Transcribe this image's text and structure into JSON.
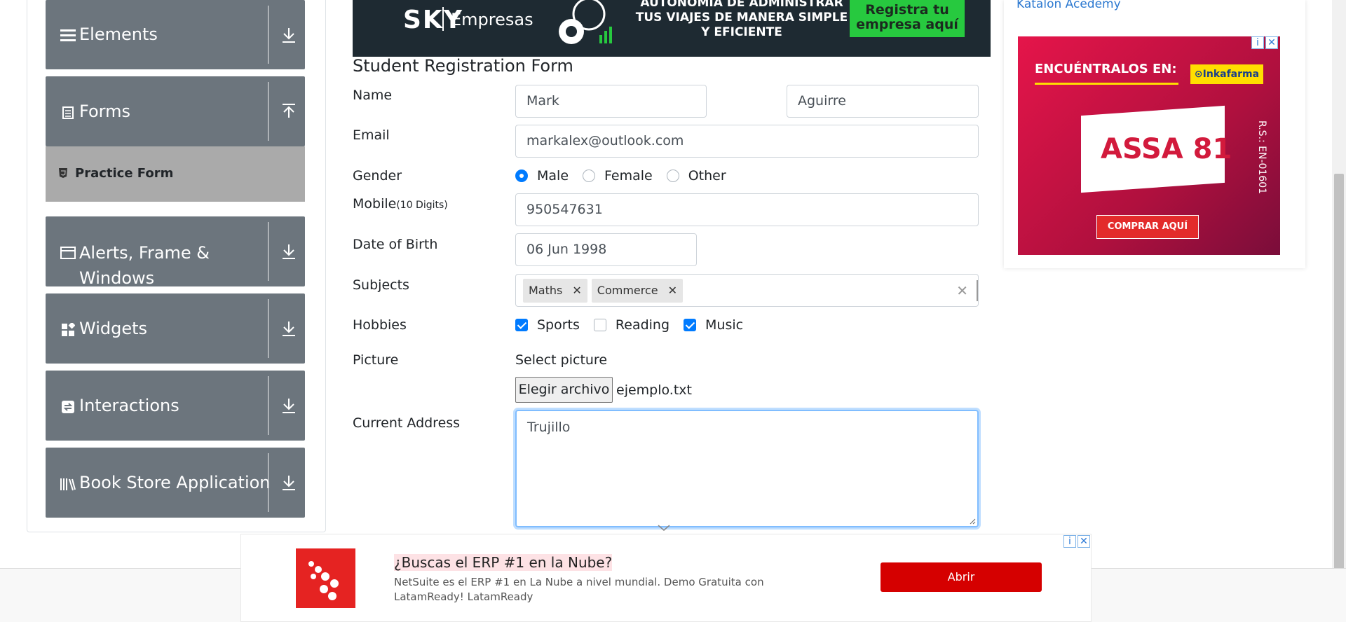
{
  "sidebar": {
    "groups": [
      {
        "label": "Elements",
        "icon": "hamburger-icon",
        "arrow": "download-arrow-icon"
      },
      {
        "label": "Forms",
        "icon": "document-icon",
        "arrow": "upload-arrow-icon"
      },
      {
        "label": "Alerts, Frame & Windows",
        "icon": "window-icon",
        "arrow": "download-arrow-icon"
      },
      {
        "label": "Widgets",
        "icon": "widgets-icon",
        "arrow": "download-arrow-icon"
      },
      {
        "label": "Interactions",
        "icon": "interactions-icon",
        "arrow": "download-arrow-icon"
      },
      {
        "label": "Book Store Application",
        "icon": "books-icon",
        "arrow": "download-arrow-icon"
      }
    ],
    "active_item": "Practice Form"
  },
  "banner": {
    "brand": "SKY",
    "brand_suffix": "Empresas",
    "copy": "AUTONOMÍA DE ADMINISTRAR TUS VIAJES DE MANERA SIMPLE Y EFICIENTE",
    "cta": "Registra tu empresa aquí"
  },
  "form": {
    "title": "Student Registration Form",
    "labels": {
      "name": "Name",
      "email": "Email",
      "gender": "Gender",
      "mobile": "Mobile",
      "mobile_hint": "(10 Digits)",
      "dob": "Date of Birth",
      "subjects": "Subjects",
      "hobbies": "Hobbies",
      "picture": "Picture",
      "address": "Current Address"
    },
    "first_name": "Mark",
    "last_name": "Aguirre",
    "email": "markalex@outlook.com",
    "gender_options": [
      "Male",
      "Female",
      "Other"
    ],
    "gender_selected": "Male",
    "mobile": "950547631",
    "dob": "06 Jun 1998",
    "subjects": [
      "Maths",
      "Commerce"
    ],
    "hobbies": [
      {
        "label": "Sports",
        "checked": true
      },
      {
        "label": "Reading",
        "checked": false
      },
      {
        "label": "Music",
        "checked": true
      }
    ],
    "picture_label": "Select picture",
    "file_button": "Elegir archivo",
    "file_name": "ejemplo.txt",
    "address": "Trujillo"
  },
  "right_ad": {
    "katalon_alt": "Katalon Acedemy",
    "headline": "ENCUÉNTRALOS EN:",
    "brand": "⊙Inkafarma",
    "product": "ASSA 81",
    "side_text": "R.S.: EN-01601",
    "cta": "COMPRAR AQUÍ"
  },
  "bottom_ad": {
    "headline": "¿Buscas el ERP #1 en la Nube?",
    "body": "NetSuite es el ERP #1 en La Nube a nivel mundial. Demo Gratuita con LatamReady! LatamReady",
    "cta": "Abrir"
  },
  "colors": {
    "sidebar_group": "#6c757d",
    "active_item": "#aaaaaa",
    "primary": "#007bff",
    "ad_red": "#d50000"
  }
}
